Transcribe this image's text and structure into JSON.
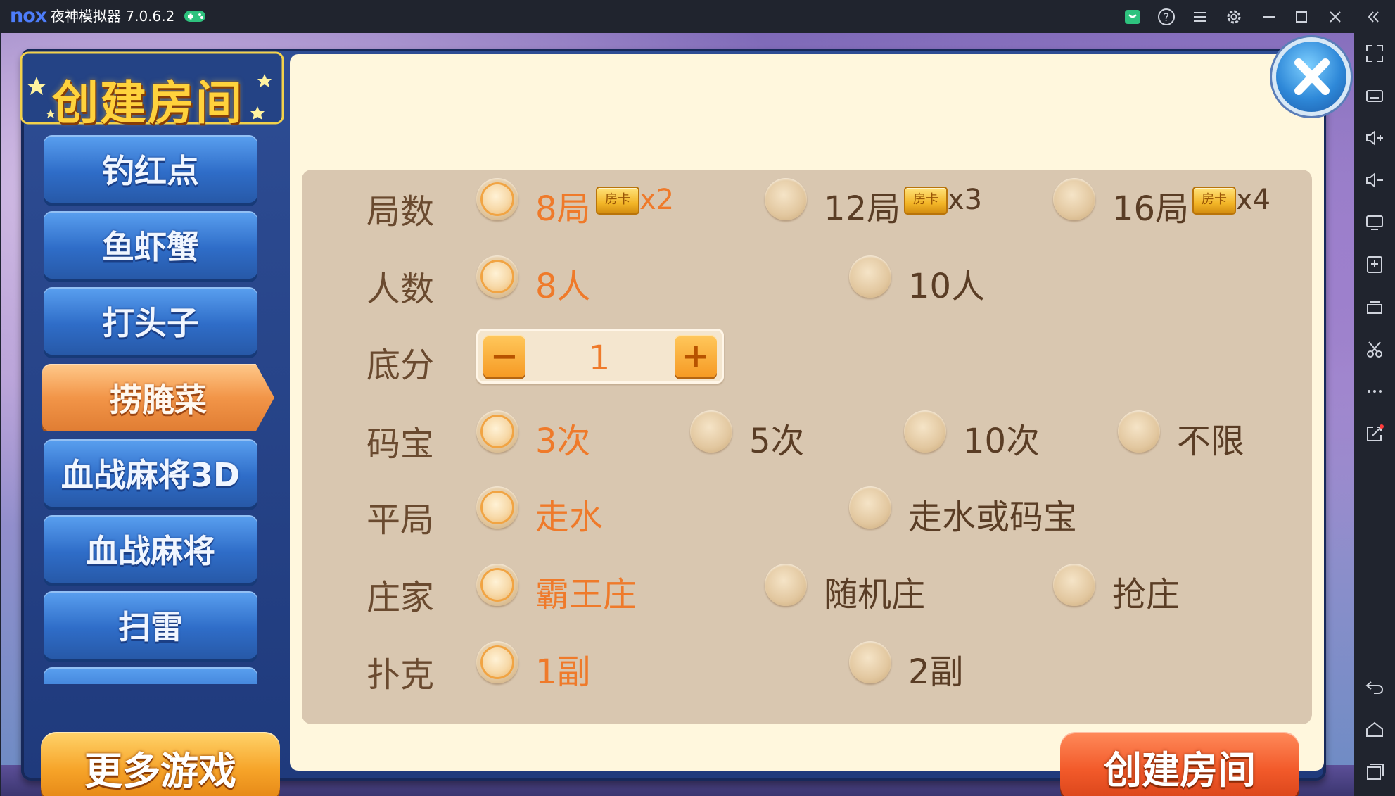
{
  "emulator": {
    "logo": "nox",
    "title": "夜神模拟器 7.0.6.2",
    "title_buttons": [
      "store-icon",
      "help-icon",
      "menu-icon",
      "settings-icon",
      "minimize-icon",
      "maximize-icon",
      "close-icon",
      "collapse-icon"
    ],
    "sidebar_buttons": [
      "fullscreen-icon",
      "keyboard-icon",
      "volume-up-icon",
      "volume-down-icon",
      "screen-icon",
      "apk-install-icon",
      "multi-instance-icon",
      "scissors-icon",
      "more-icon",
      "share-icon",
      "back-icon",
      "home-icon",
      "recent-apps-icon"
    ]
  },
  "dialog": {
    "title": "创建房间",
    "games": [
      "钓红点",
      "鱼虾蟹",
      "打头子",
      "捞腌菜",
      "血战麻将3D",
      "血战麻将",
      "扫雷"
    ],
    "active_game": "捞腌菜",
    "more_games": "更多游戏",
    "create_button": "创建房间"
  },
  "options": {
    "rounds": {
      "label": "局数",
      "choices": [
        {
          "text": "8局",
          "card": "房卡",
          "mult": "x2",
          "selected": true
        },
        {
          "text": "12局",
          "card": "房卡",
          "mult": "x3",
          "selected": false
        },
        {
          "text": "16局",
          "card": "房卡",
          "mult": "x4",
          "selected": false
        }
      ]
    },
    "players": {
      "label": "人数",
      "choices": [
        {
          "text": "8人",
          "selected": true
        },
        {
          "text": "10人",
          "selected": false
        }
      ]
    },
    "base_score": {
      "label": "底分",
      "value": "1",
      "minus": "−",
      "plus": "+"
    },
    "bonus": {
      "label": "码宝",
      "choices": [
        {
          "text": "3次",
          "selected": true
        },
        {
          "text": "5次",
          "selected": false
        },
        {
          "text": "10次",
          "selected": false
        },
        {
          "text": "不限",
          "selected": false
        }
      ]
    },
    "draw": {
      "label": "平局",
      "choices": [
        {
          "text": "走水",
          "selected": true
        },
        {
          "text": "走水或码宝",
          "selected": false
        }
      ]
    },
    "banker": {
      "label": "庄家",
      "choices": [
        {
          "text": "霸王庄",
          "selected": true
        },
        {
          "text": "随机庄",
          "selected": false
        },
        {
          "text": "抢庄",
          "selected": false
        }
      ]
    },
    "poker": {
      "label": "扑克",
      "choices": [
        {
          "text": "1副",
          "selected": true
        },
        {
          "text": "2副",
          "selected": false
        }
      ]
    }
  },
  "colors": {
    "selected_text": "#ef7a2a",
    "normal_text": "#5a3d25",
    "label_text": "#6a4a2f",
    "panel_blue": "#2e4d94"
  }
}
